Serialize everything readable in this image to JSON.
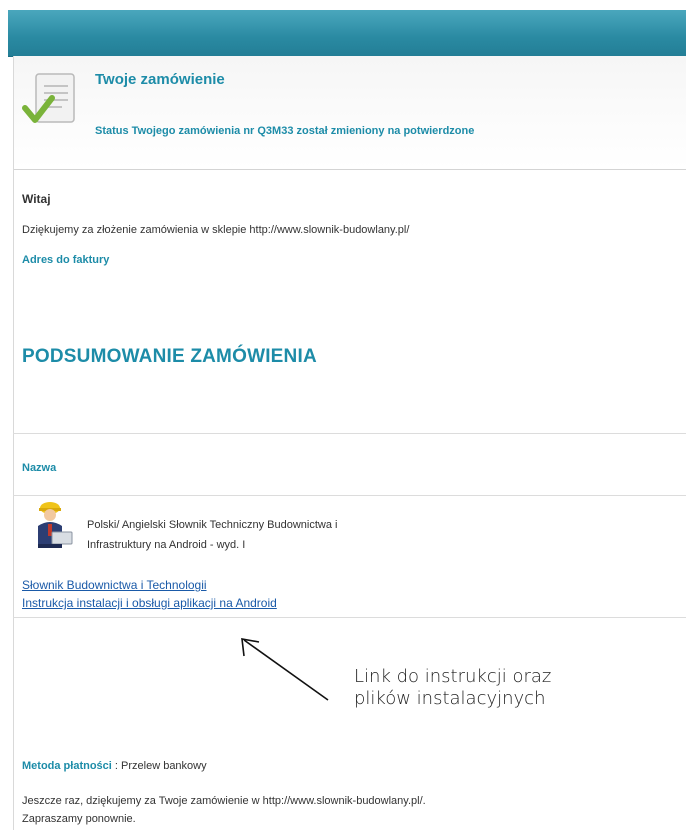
{
  "header": {
    "title": "Twoje zamówienie",
    "status": "Status Twojego zamówienia nr Q3M33 został zmieniony na potwierdzone"
  },
  "greeting": "Witaj",
  "thanks": "Dziękujemy za złożenie zamówienia w sklepie http://www.slownik-budowlany.pl/",
  "billing_label": "Adres do faktury",
  "summary": {
    "title": "PODSUMOWANIE ZAMÓWIENIA",
    "column_header": "Nazwa"
  },
  "product": {
    "name_line1": "Polski/ Angielski Słownik Techniczny Budownictwa i",
    "name_line2": "Infrastruktury na Android - wyd. I"
  },
  "links": [
    "Słownik Budownictwa i Technologii",
    "Instrukcja instalacji i obsługi aplikacji na Android"
  ],
  "annotation": {
    "line1": "Link do instrukcji oraz",
    "line2": "plików instalacyjnych"
  },
  "payment": {
    "label": "Metoda płatności",
    "separator": " : ",
    "value": "Przelew bankowy"
  },
  "closing": {
    "line1": "Jeszcze raz, dziękujemy za Twoje zamówienie w http://www.slownik-budowlany.pl/.",
    "line2": "Zapraszamy ponownie."
  },
  "colors": {
    "accent": "#1d8ca8",
    "link": "#1a5aa8",
    "topbar": "#2a8aa2"
  }
}
